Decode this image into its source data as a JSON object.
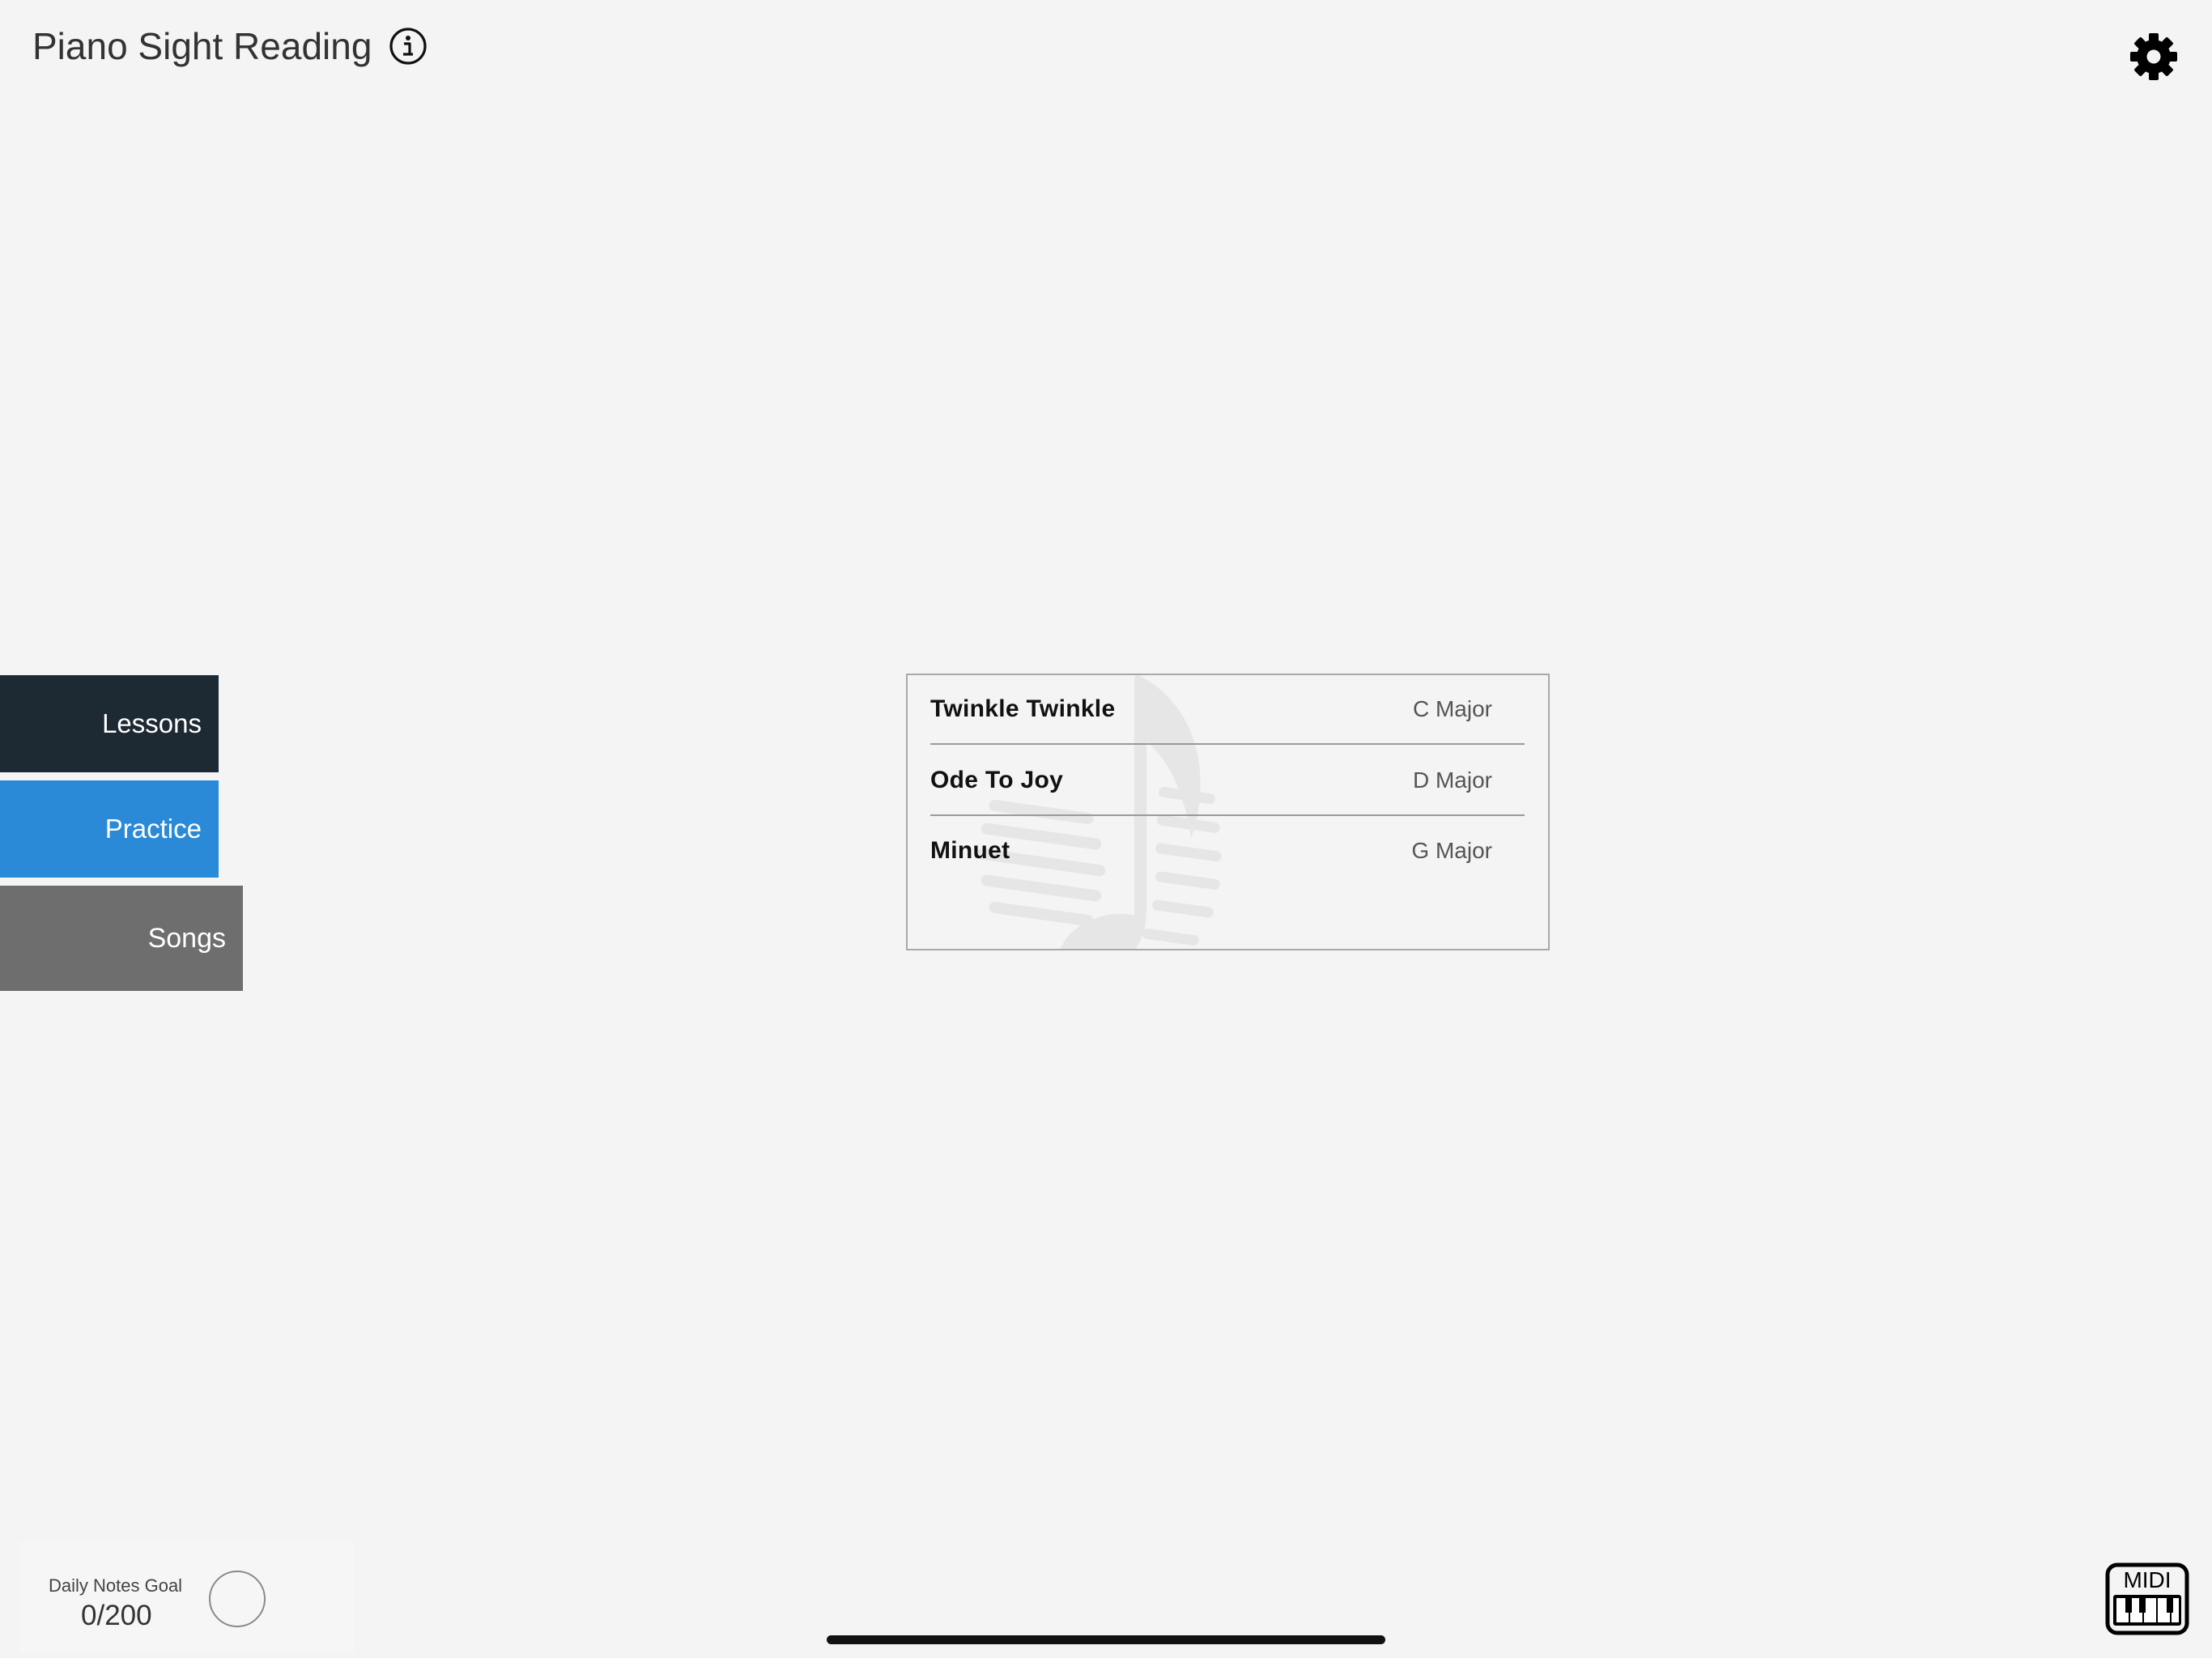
{
  "header": {
    "title": "Piano Sight Reading",
    "info_icon": "info-circle-icon",
    "settings_icon": "gear-icon"
  },
  "nav": {
    "items": [
      {
        "label": "Lessons",
        "color": "#1e2a33"
      },
      {
        "label": "Practice",
        "color": "#2a8ad8"
      },
      {
        "label": "Songs",
        "color": "#6e6e6e"
      }
    ]
  },
  "songs": [
    {
      "name": "Twinkle Twinkle",
      "key": "C Major"
    },
    {
      "name": "Ode To Joy",
      "key": "D Major"
    },
    {
      "name": "Minuet",
      "key": "G Major"
    }
  ],
  "daily_goal": {
    "label": "Daily Notes Goal",
    "value": "0/200",
    "progress": 0
  },
  "midi": {
    "label": "MIDI",
    "icon": "piano-keyboard-icon"
  }
}
